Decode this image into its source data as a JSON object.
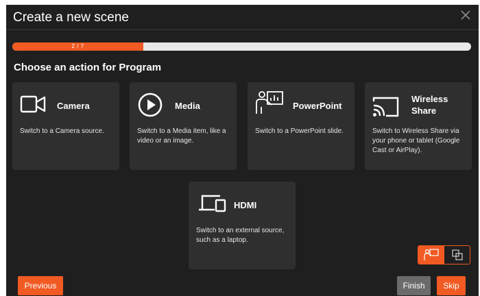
{
  "dialog": {
    "title": "Create a new scene",
    "progress": {
      "label": "2 / 7",
      "current": 2,
      "total": 7
    },
    "subtitle": "Choose an action for Program",
    "cards": [
      {
        "label": "Camera",
        "description": "Switch to a Camera source.",
        "icon": "camera-icon"
      },
      {
        "label": "Media",
        "description": "Switch to a Media item, like a video or an image.",
        "icon": "play-icon"
      },
      {
        "label": "PowerPoint",
        "description": "Switch to a PowerPoint slide.",
        "icon": "presenter-icon"
      },
      {
        "label": "Wireless Share",
        "description": "Switch to Wireless Share via your phone or tablet (Google Cast or AirPlay).",
        "icon": "cast-icon"
      },
      {
        "label": "HDMI",
        "description": "Switch to an external source, such as a laptop.",
        "icon": "devices-icon"
      }
    ],
    "buttons": {
      "previous": "Previous",
      "finish": "Finish",
      "skip": "Skip"
    },
    "colors": {
      "accent": "#f15a22",
      "background": "#1f1f1f",
      "card": "#2f2f2f",
      "neutral_button": "#6b6b6b"
    }
  }
}
